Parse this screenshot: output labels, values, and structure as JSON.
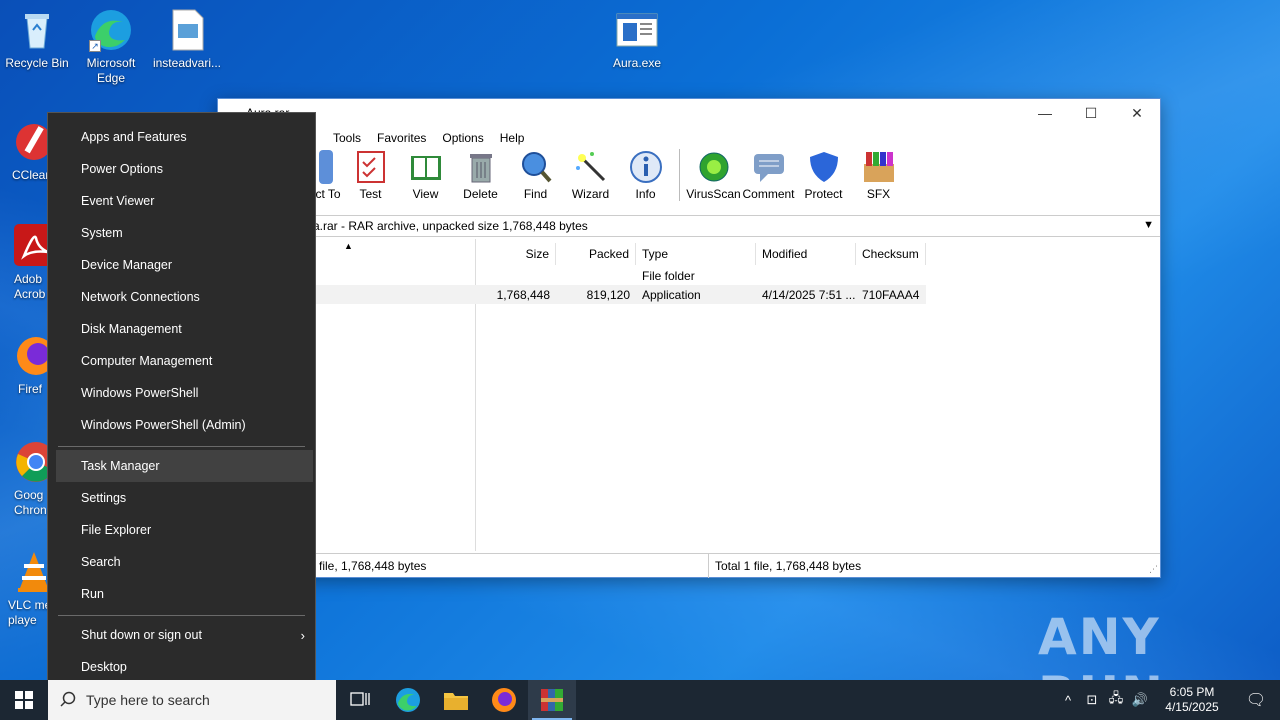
{
  "desktop": {
    "icons": [
      {
        "label": "Recycle Bin"
      },
      {
        "label": "Microsoft Edge"
      },
      {
        "label": "insteadvari..."
      },
      {
        "label": "Aura.exe"
      },
      {
        "label": "CClear"
      },
      {
        "label": "Adob Acrob"
      },
      {
        "label": "Firef"
      },
      {
        "label": "Goog Chron"
      },
      {
        "label": "VLC me playe"
      }
    ]
  },
  "winrar": {
    "title": "Aura.rar",
    "menu": [
      "Tools",
      "Favorites",
      "Options",
      "Help"
    ],
    "toolbar": [
      "ct To",
      "Test",
      "View",
      "Delete",
      "Find",
      "Wizard",
      "Info",
      "VirusScan",
      "Comment",
      "Protect",
      "SFX"
    ],
    "address": "a.rar - RAR archive, unpacked size 1,768,448 bytes",
    "columns": [
      "Size",
      "Packed",
      "Type",
      "Modified",
      "Checksum"
    ],
    "rows": [
      {
        "size": "",
        "packed": "",
        "type": "File folder",
        "modified": "",
        "checksum": ""
      },
      {
        "size": "1,768,448",
        "packed": "819,120",
        "type": "Application",
        "modified": "4/14/2025 7:51 ...",
        "checksum": "710FAAA4"
      }
    ],
    "status_left": "file, 1,768,448 bytes",
    "status_right": "Total 1 file, 1,768,448 bytes"
  },
  "context_menu": {
    "items": [
      "Apps and Features",
      "Power Options",
      "Event Viewer",
      "System",
      "Device Manager",
      "Network Connections",
      "Disk Management",
      "Computer Management",
      "Windows PowerShell",
      "Windows PowerShell (Admin)",
      "Task Manager",
      "Settings",
      "File Explorer",
      "Search",
      "Run",
      "Shut down or sign out",
      "Desktop"
    ]
  },
  "taskbar": {
    "search_placeholder": "Type here to search",
    "time": "6:05 PM",
    "date": "4/15/2025"
  },
  "watermark": "ANY RUN"
}
